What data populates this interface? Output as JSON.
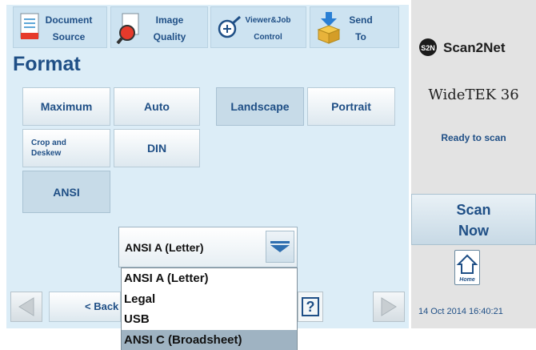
{
  "tabs": [
    {
      "line1": "Document",
      "line2": "Source"
    },
    {
      "line1": "Image",
      "line2": "Quality"
    },
    {
      "line1": "Viewer&Job",
      "line2": "Control"
    },
    {
      "line1": "Send",
      "line2": "To"
    }
  ],
  "format": {
    "title": "Format",
    "size_buttons": {
      "maximum": "Maximum",
      "auto": "Auto",
      "crop_deskew_1": "Crop and",
      "crop_deskew_2": "Deskew",
      "din": "DIN",
      "ansi": "ANSI"
    },
    "orientation_buttons": {
      "landscape": "Landscape",
      "portrait": "Portrait"
    },
    "selected_size_button": "ANSI",
    "selected_orientation": "Landscape"
  },
  "dropdown": {
    "value": "ANSI A (Letter)",
    "options": [
      "ANSI A (Letter)",
      "Legal",
      "USB",
      "ANSI C (Broadsheet)"
    ],
    "highlighted_option": "ANSI C (Broadsheet)"
  },
  "nav": {
    "back_label": "< Back",
    "help_label": "?"
  },
  "right": {
    "logo_text": "Scan2Net",
    "logo_mark": "S2N",
    "model": "WideTEK 36",
    "status": "Ready to scan",
    "scan_now_line1": "Scan",
    "scan_now_line2": "Now",
    "home_label": "Home",
    "datetime": "14 Oct 2014 16:40:21"
  },
  "colors": {
    "accent": "#1f4f86",
    "panel_bg": "#dcedf7",
    "right_bg": "#e3e3e3",
    "selected": "#c7dbe8",
    "highlight": "#9fb3c2"
  }
}
